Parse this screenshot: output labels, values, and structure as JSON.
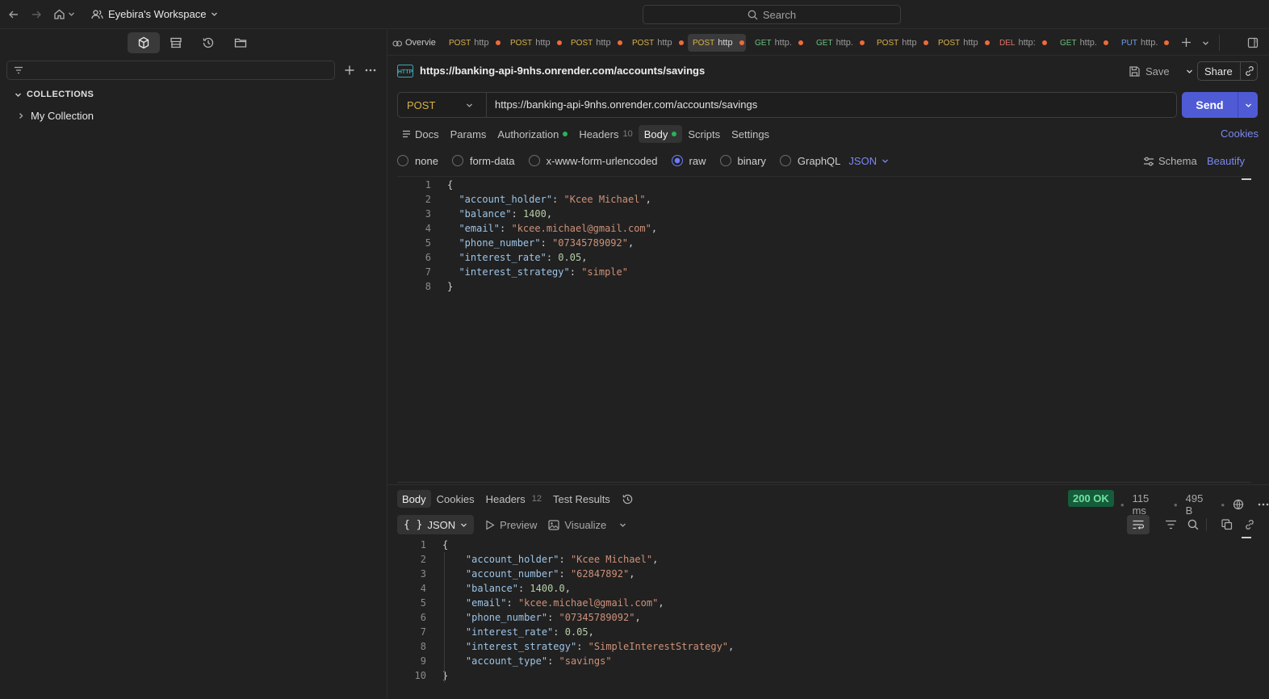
{
  "topbar": {
    "workspace": "Eyebira's Workspace",
    "search_placeholder": "Search"
  },
  "sidebar": {
    "section_title": "COLLECTIONS",
    "items": [
      {
        "label": "My Collection"
      }
    ]
  },
  "tabs": [
    {
      "method": "",
      "label": "Overvie",
      "dirty": false
    },
    {
      "method": "POST",
      "label": "http",
      "dirty": true
    },
    {
      "method": "POST",
      "label": "http",
      "dirty": true
    },
    {
      "method": "POST",
      "label": "http",
      "dirty": true
    },
    {
      "method": "POST",
      "label": "http",
      "dirty": true
    },
    {
      "method": "POST",
      "label": "http",
      "dirty": true,
      "active": true
    },
    {
      "method": "GET",
      "label": "http.",
      "dirty": true
    },
    {
      "method": "GET",
      "label": "http.",
      "dirty": true
    },
    {
      "method": "POST",
      "label": "http",
      "dirty": true
    },
    {
      "method": "POST",
      "label": "http",
      "dirty": true
    },
    {
      "method": "DEL",
      "label": "http:",
      "dirty": true
    },
    {
      "method": "GET",
      "label": "http.",
      "dirty": true
    },
    {
      "method": "PUT",
      "label": "http.",
      "dirty": true
    }
  ],
  "request": {
    "title": "https://banking-api-9nhs.onrender.com/accounts/savings",
    "method": "POST",
    "url": "https://banking-api-9nhs.onrender.com/accounts/savings",
    "save_label": "Save",
    "share_label": "Share",
    "send_label": "Send",
    "tabs": {
      "docs": "Docs",
      "params": "Params",
      "authorization": "Authorization",
      "headers": "Headers",
      "headers_count": "10",
      "body": "Body",
      "scripts": "Scripts",
      "settings": "Settings"
    },
    "cookies_label": "Cookies",
    "body_types": {
      "none": "none",
      "form_data": "form-data",
      "urlencoded": "x-www-form-urlencoded",
      "raw": "raw",
      "binary": "binary",
      "graphql": "GraphQL",
      "format": "JSON"
    },
    "schema_label": "Schema",
    "beautify_label": "Beautify",
    "body_lines": [
      "{",
      "  \"account_holder\": \"Kcee Michael\",",
      "  \"balance\": 1400,",
      "  \"email\": \"kcee.michael@gmail.com\",",
      "  \"phone_number\": \"07345789092\",",
      "  \"interest_rate\": 0.05,",
      "  \"interest_strategy\": \"simple\"",
      "}"
    ]
  },
  "response": {
    "tabs": {
      "body": "Body",
      "cookies": "Cookies",
      "headers": "Headers",
      "headers_count": "12",
      "test_results": "Test Results"
    },
    "status": "200 OK",
    "time": "115 ms",
    "size": "495 B",
    "format": "JSON",
    "preview_label": "Preview",
    "visualize_label": "Visualize",
    "body_lines": [
      "{",
      "    \"account_holder\": \"Kcee Michael\",",
      "    \"account_number\": \"62847892\",",
      "    \"balance\": 1400.0,",
      "    \"email\": \"kcee.michael@gmail.com\",",
      "    \"phone_number\": \"07345789092\",",
      "    \"interest_rate\": 0.05,",
      "    \"interest_strategy\": \"SimpleInterestStrategy\",",
      "    \"account_type\": \"savings\"",
      "}"
    ]
  }
}
